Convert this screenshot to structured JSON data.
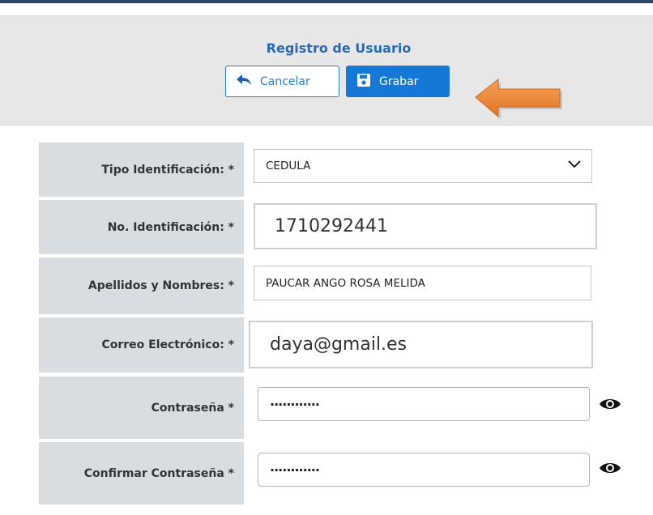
{
  "header": {
    "title": "Registro de Usuario",
    "cancel_label": "Cancelar",
    "save_label": "Grabar",
    "accent_color": "#1479d6",
    "arrow_color": "#f08a3c"
  },
  "form": {
    "tipo_identificacion": {
      "label": "Tipo Identificación: *",
      "value": "CEDULA"
    },
    "no_identificacion": {
      "label": "No. Identificación: *",
      "value": "1710292441"
    },
    "apellidos_nombres": {
      "label": "Apellidos y Nombres: *",
      "value": "PAUCAR ANGO ROSA MELIDA"
    },
    "correo": {
      "label": "Correo Electrónico: *",
      "value": "daya@gmail.es"
    },
    "contrasena": {
      "label": "Contraseña *",
      "value": "············"
    },
    "confirmar_contrasena": {
      "label": "Confirmar Contraseña *",
      "value": "············"
    }
  },
  "icons": {
    "cancel": "reply-arrow-icon",
    "save": "floppy-disk-icon",
    "select": "chevron-down-icon",
    "show_password": "eye-icon"
  }
}
